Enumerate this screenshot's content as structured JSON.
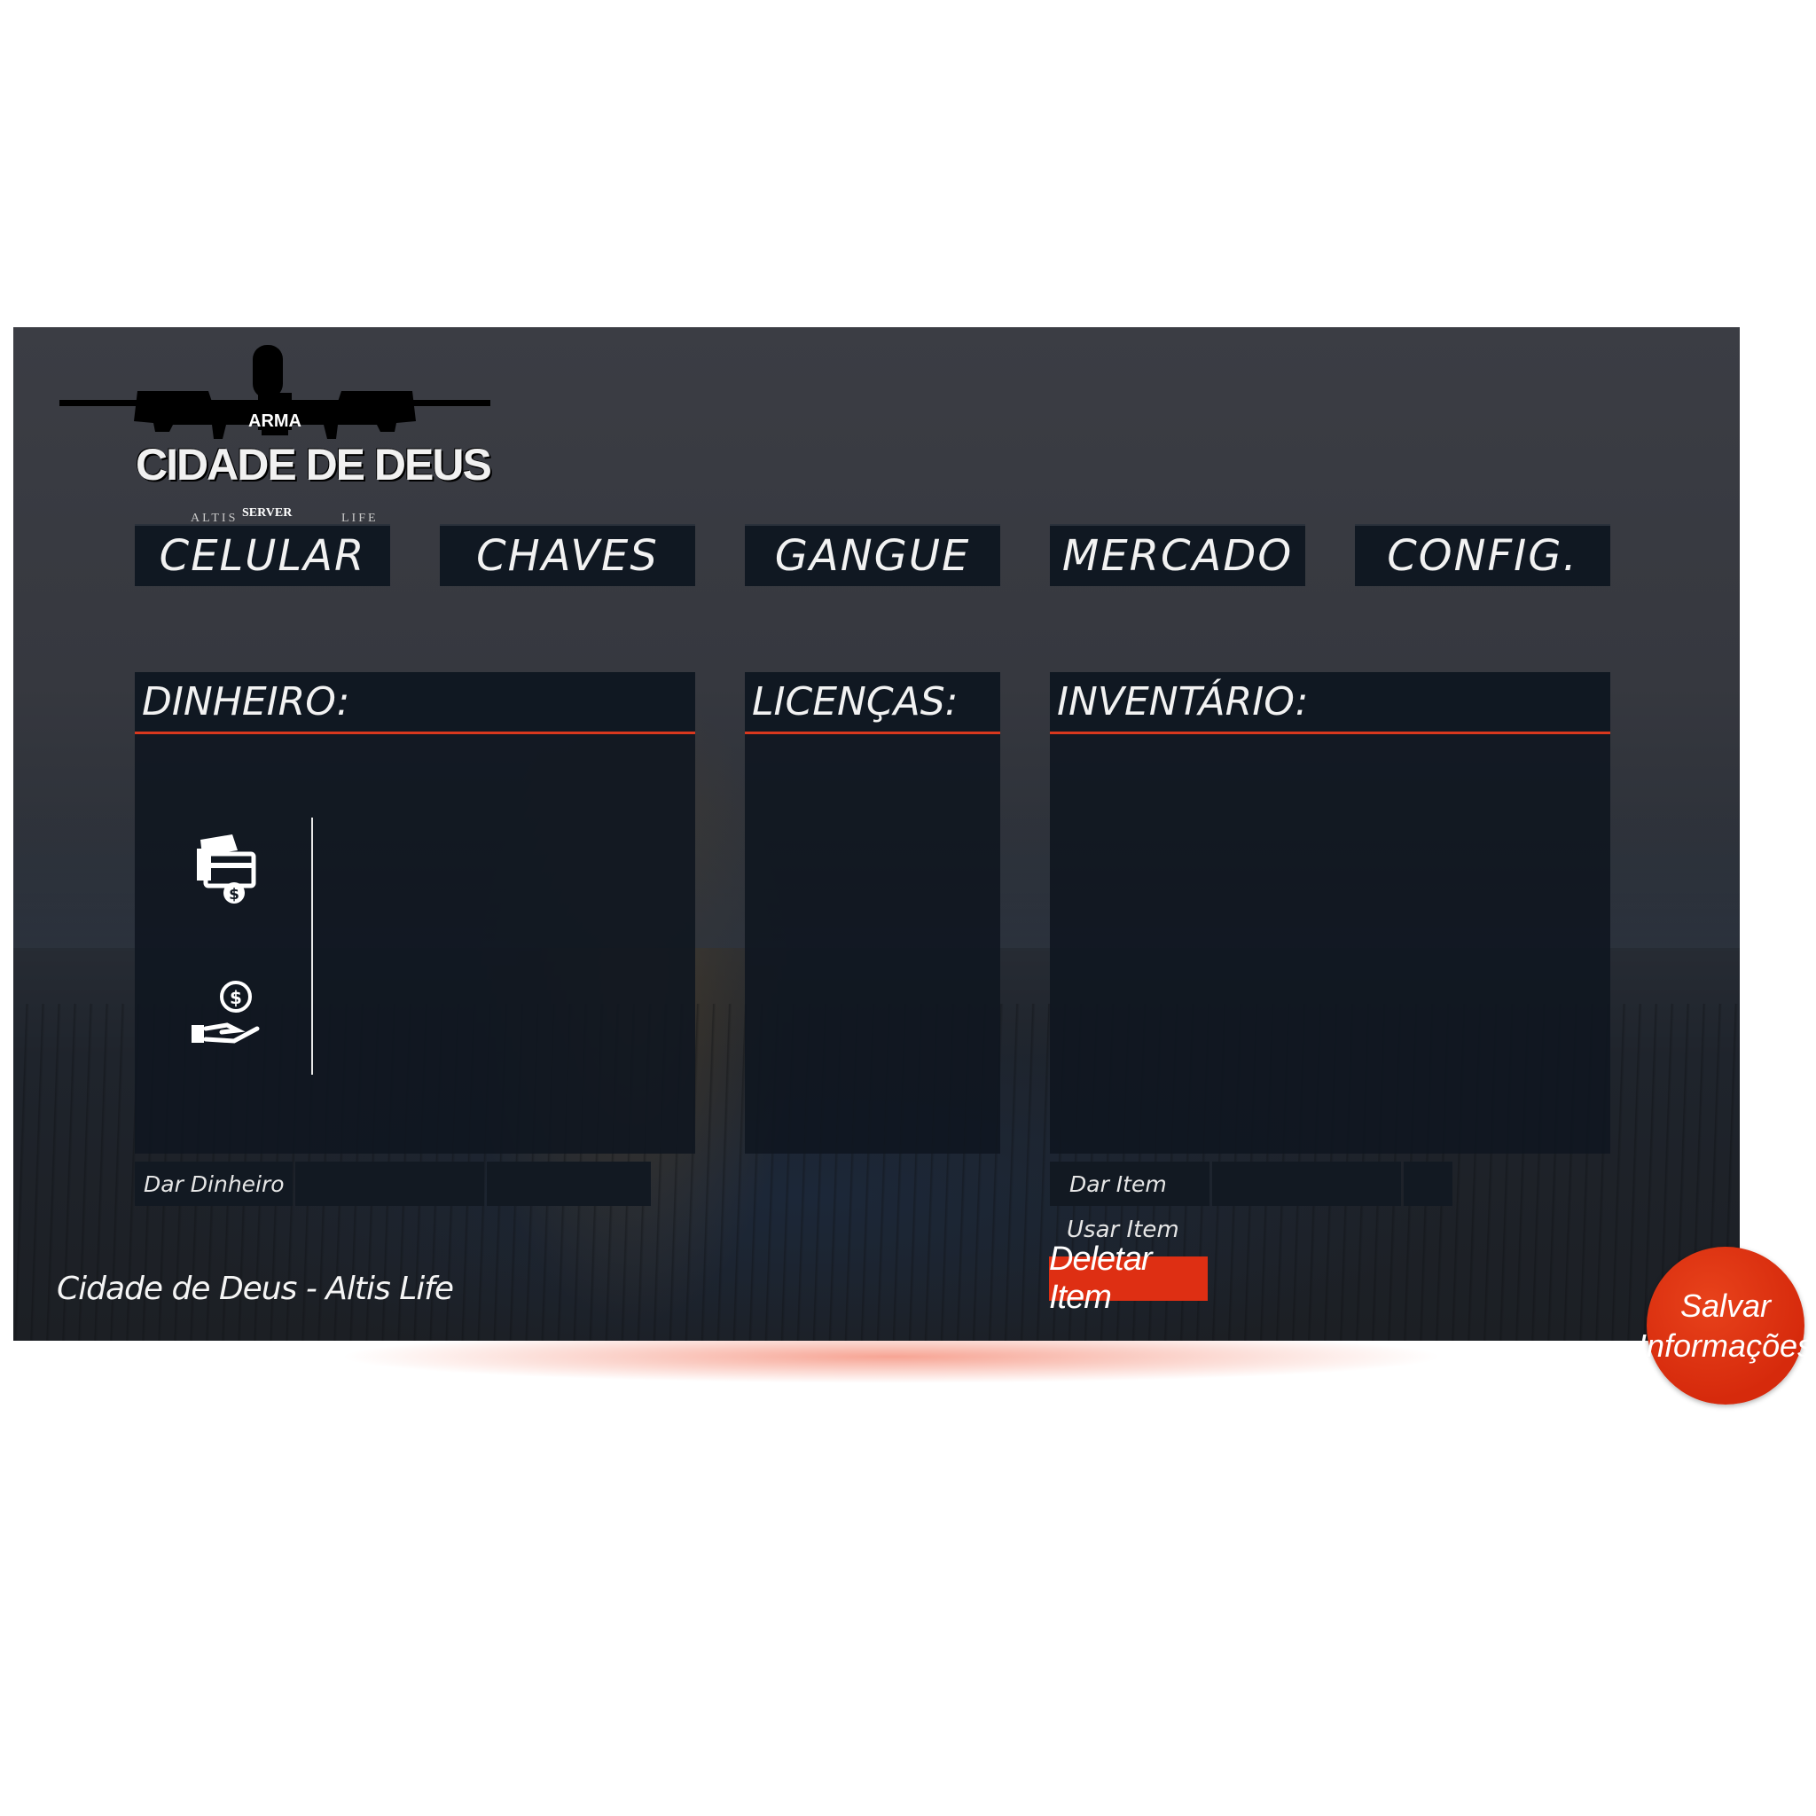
{
  "logo": {
    "arma_mark": "ARMA",
    "title": "CIDADE DE DEUS",
    "server_label": "SERVER",
    "left_caption": "ALTIS",
    "right_caption": "LIFE"
  },
  "nav": {
    "tabs": [
      {
        "label": "CELULAR"
      },
      {
        "label": "CHAVES"
      },
      {
        "label": "GANGUE"
      },
      {
        "label": "MERCADO"
      },
      {
        "label": "CONFIG."
      }
    ]
  },
  "panels": {
    "money": {
      "title": "DINHEIRO:",
      "icons": [
        "card-cash-icon",
        "hand-coin-icon"
      ]
    },
    "licenses": {
      "title": "LICENÇAS:"
    },
    "inventory": {
      "title": "INVENTÁRIO:"
    }
  },
  "money_actions": {
    "give_label": "Dar Dinheiro"
  },
  "inventory_actions": {
    "give_label": "Dar Item",
    "use_label": "Usar Item",
    "delete_label": "Deletar Item"
  },
  "footer": {
    "text": "Cidade de Deus - Altis Life"
  },
  "save_button": {
    "line1": "Salvar",
    "line2": "Informações"
  },
  "colors": {
    "accent": "#d9381e",
    "panel_bg": "#101822",
    "delete_bg": "#de2f13"
  }
}
